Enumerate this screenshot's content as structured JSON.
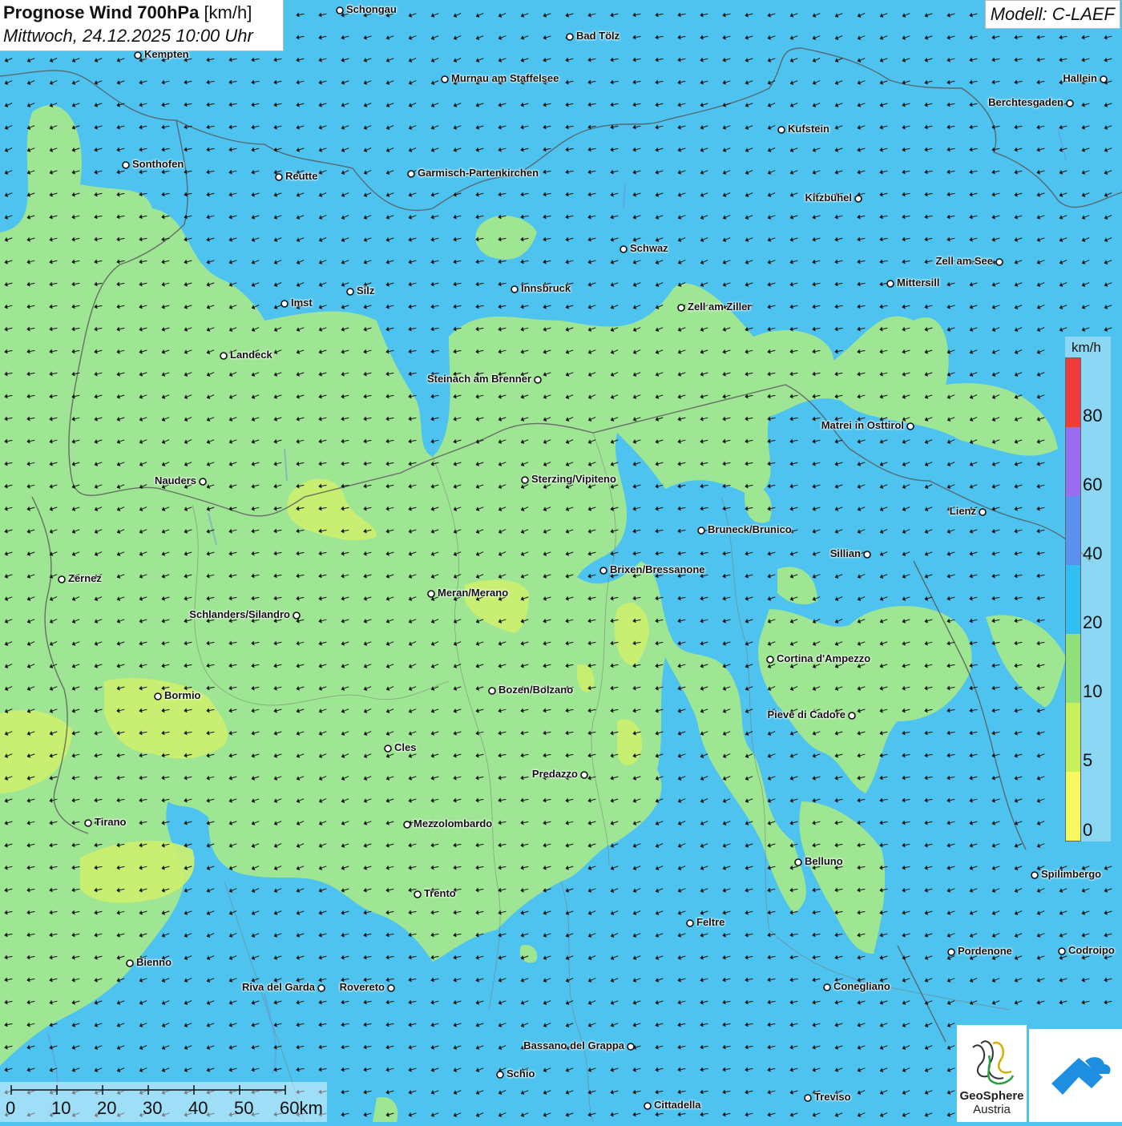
{
  "title": {
    "bold": "Prognose Wind 700hPa",
    "unit": "[km/h]",
    "datetime": "Mittwoch, 24.12.2025 10:00 Uhr"
  },
  "model": "Modell: C-LAEF",
  "legend": {
    "unit": "km/h",
    "ticks": [
      "80",
      "60",
      "40",
      "20",
      "10",
      "5",
      "0"
    ],
    "colors": [
      "#ef3b3b",
      "#9a6cf0",
      "#5b8ff0",
      "#30bff0",
      "#8fe07a",
      "#c9f05a",
      "#f8f860"
    ]
  },
  "scale": {
    "labels": [
      "0",
      "10",
      "20",
      "30",
      "40",
      "50",
      "60km"
    ]
  },
  "logos": {
    "geosphere_line1": "GeoSphere",
    "geosphere_line2": "Austria"
  },
  "cities": [
    {
      "name": "Schongau"
    },
    {
      "name": "Kempten"
    },
    {
      "name": "Bad Tölz"
    },
    {
      "name": "Murnau am Staffelsee"
    },
    {
      "name": "Hallein"
    },
    {
      "name": "Berchtesgaden"
    },
    {
      "name": "Kufstein"
    },
    {
      "name": "Sonthofen"
    },
    {
      "name": "Reutte"
    },
    {
      "name": "Garmisch-Partenkirchen"
    },
    {
      "name": "Kitzbühel"
    },
    {
      "name": "Schwaz"
    },
    {
      "name": "Zell am See"
    },
    {
      "name": "Mittersill"
    },
    {
      "name": "Innsbruck"
    },
    {
      "name": "Silz"
    },
    {
      "name": "Imst"
    },
    {
      "name": "Zell am Ziller"
    },
    {
      "name": "Landeck"
    },
    {
      "name": "Steinach am Brenner"
    },
    {
      "name": "Matrei in Osttirol"
    },
    {
      "name": "Nauders"
    },
    {
      "name": "Sterzing/Vipiteno"
    },
    {
      "name": "Lienz"
    },
    {
      "name": "Bruneck/Brunico"
    },
    {
      "name": "Sillian"
    },
    {
      "name": "Zernez"
    },
    {
      "name": "Brixen/Bressanone"
    },
    {
      "name": "Meran/Merano"
    },
    {
      "name": "Schlanders/Silandro"
    },
    {
      "name": "Cortina d'Ampezzo"
    },
    {
      "name": "Bozen/Bolzano"
    },
    {
      "name": "Bormio"
    },
    {
      "name": "Pieve di Cadore"
    },
    {
      "name": "Cles"
    },
    {
      "name": "Predazzo"
    },
    {
      "name": "Tirano"
    },
    {
      "name": "Mezzolombardo"
    },
    {
      "name": "Belluno"
    },
    {
      "name": "Spilimbergo"
    },
    {
      "name": "Trento"
    },
    {
      "name": "Feltre"
    },
    {
      "name": "Pordenone"
    },
    {
      "name": "Codroipo"
    },
    {
      "name": "Bienno"
    },
    {
      "name": "Riva del Garda"
    },
    {
      "name": "Rovereto"
    },
    {
      "name": "Conegliano"
    },
    {
      "name": "Bassano del Grappa"
    },
    {
      "name": "Schio"
    },
    {
      "name": "Treviso"
    },
    {
      "name": "Cittadella"
    }
  ]
}
